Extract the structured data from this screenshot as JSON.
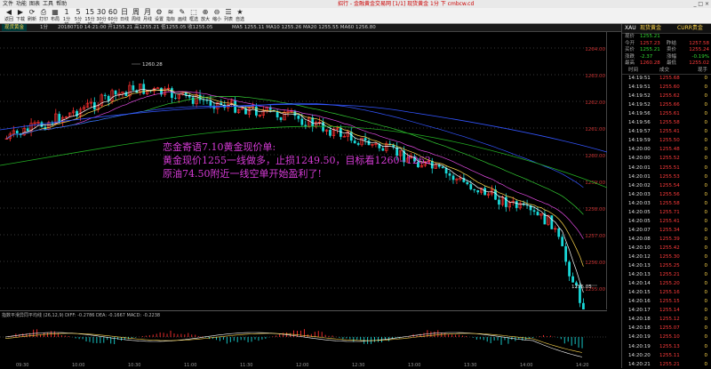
{
  "titlebar": {
    "menus": [
      "文件",
      "功能",
      "图表",
      "工具",
      "帮助"
    ],
    "title": "招行 - 金融黄金交易网 [1/1] 现货黄金 1分 下 cmbcw.cd",
    "win_controls": "_ □ ×"
  },
  "toolbar": {
    "buttons": [
      {
        "glyph": "◀",
        "label": "返回",
        "icon": "back-icon"
      },
      {
        "glyph": "▶",
        "label": "下载",
        "icon": "forward-icon"
      },
      {
        "glyph": "⟳",
        "label": "刷新",
        "icon": "refresh-icon"
      },
      {
        "glyph": "⎙",
        "label": "打印",
        "icon": "print-icon"
      },
      {
        "glyph": "▦",
        "label": "布局",
        "icon": "layout-icon"
      },
      {
        "glyph": "1",
        "label": "1分钟"
      },
      {
        "glyph": "5",
        "label": "5分钟"
      },
      {
        "glyph": "15",
        "label": "15分钟"
      },
      {
        "glyph": "30",
        "label": "30分钟"
      },
      {
        "glyph": "60",
        "label": "60分钟"
      },
      {
        "glyph": "日",
        "label": "日线"
      },
      {
        "glyph": "周",
        "label": "周线"
      },
      {
        "glyph": "月",
        "label": "月线"
      },
      {
        "glyph": "⚙",
        "label": "设置",
        "icon": "gear-icon"
      },
      {
        "glyph": "≋",
        "label": "指标",
        "icon": "indicator-icon"
      },
      {
        "glyph": "✎",
        "label": "画线",
        "icon": "pencil-icon"
      },
      {
        "glyph": "⬚",
        "label": "框选",
        "icon": "select-icon"
      },
      {
        "glyph": "⊕",
        "label": "放大",
        "icon": "zoom-in-icon"
      },
      {
        "glyph": "⊖",
        "label": "缩小",
        "icon": "zoom-out-icon"
      },
      {
        "glyph": "☰",
        "label": "列表",
        "icon": "list-icon"
      },
      {
        "glyph": "★",
        "label": "自选",
        "icon": "star-icon"
      }
    ]
  },
  "tabs": [
    {
      "label": "现货黄金",
      "active": true
    },
    {
      "label": "1分"
    },
    {
      "label": "20180710 14:21:00 开1255.21 高1255.21 低1255.05 收1255.05"
    },
    {
      "label": "MA5 1255.11 MA10 1255.26 MA20 1255.55 MA60 1256.80"
    }
  ],
  "chart": {
    "price_labels": [
      "1264.00",
      "1263.00",
      "1262.00",
      "1261.00",
      "1260.00",
      "1259.00",
      "1258.00",
      "1257.00",
      "1256.00",
      "1255.00"
    ],
    "high_label": "1260.28",
    "low_label": "1255.05",
    "sub_label": "指数平滑异同平均线 (26,12,9)  DIFF: -0.2786  DEA: -0.1667  MACD: -0.2238",
    "time_labels": [
      "09:30",
      "10:00",
      "10:30",
      "11:00",
      "11:30",
      "12:00",
      "12:30",
      "13:00",
      "13:30",
      "14:00",
      "14:20"
    ]
  },
  "annotation": {
    "line1": "恋金寄语7.10黄金现价单:",
    "line2": "黄金现价1255一线做多，止损1249.50，目标看1260--1262",
    "line3": "原油74.50附近一线空单开始盈利了!"
  },
  "quote": {
    "symbol": "XAU",
    "name": "现货黄金",
    "currency": "CURR贵金",
    "rows": [
      {
        "label": "现价",
        "value": "1255.21",
        "label2": "",
        "value2": ""
      },
      {
        "label": "今开",
        "value": "1257.23",
        "label2": "昨结",
        "value2": "1257.58"
      },
      {
        "label": "买价",
        "value": "1255.21",
        "label2": "卖价",
        "value2": "1255.24"
      },
      {
        "label": "涨跌",
        "value": "-2.37",
        "label2": "涨幅",
        "value2": "-0.19%"
      },
      {
        "label": "最高",
        "value": "1260.28",
        "label2": "最低",
        "value2": "1255.02"
      }
    ],
    "header": {
      "time": "时间",
      "price": "成交",
      "vol": "现手"
    },
    "ticks": [
      {
        "t": "14:19:51",
        "p": "1255.68",
        "v": "0"
      },
      {
        "t": "14:19:51",
        "p": "1255.60",
        "v": "0"
      },
      {
        "t": "14:19:52",
        "p": "1255.62",
        "v": "0"
      },
      {
        "t": "14:19:52",
        "p": "1255.66",
        "v": "0"
      },
      {
        "t": "14:19:56",
        "p": "1255.61",
        "v": "0"
      },
      {
        "t": "14:19:56",
        "p": "1255.58",
        "v": "0"
      },
      {
        "t": "14:19:57",
        "p": "1255.41",
        "v": "0"
      },
      {
        "t": "14:19:59",
        "p": "1255.50",
        "v": "0"
      },
      {
        "t": "14:20:00",
        "p": "1255.48",
        "v": "0"
      },
      {
        "t": "14:20:00",
        "p": "1255.52",
        "v": "0"
      },
      {
        "t": "14:20:01",
        "p": "1255.51",
        "v": "0"
      },
      {
        "t": "14:20:01",
        "p": "1255.53",
        "v": "0"
      },
      {
        "t": "14:20:02",
        "p": "1255.54",
        "v": "0"
      },
      {
        "t": "14:20:03",
        "p": "1255.56",
        "v": "0"
      },
      {
        "t": "14:20:03",
        "p": "1255.58",
        "v": "0"
      },
      {
        "t": "14:20:05",
        "p": "1255.71",
        "v": "0"
      },
      {
        "t": "14:20:05",
        "p": "1255.41",
        "v": "0"
      },
      {
        "t": "14:20:07",
        "p": "1255.34",
        "v": "0"
      },
      {
        "t": "14:20:08",
        "p": "1255.39",
        "v": "0"
      },
      {
        "t": "14:20:10",
        "p": "1255.42",
        "v": "0"
      },
      {
        "t": "14:20:12",
        "p": "1255.30",
        "v": "0"
      },
      {
        "t": "14:20:13",
        "p": "1255.25",
        "v": "0"
      },
      {
        "t": "14:20:13",
        "p": "1255.21",
        "v": "0"
      },
      {
        "t": "14:20:14",
        "p": "1255.20",
        "v": "0"
      },
      {
        "t": "14:20:15",
        "p": "1255.16",
        "v": "0"
      },
      {
        "t": "14:20:16",
        "p": "1255.15",
        "v": "0"
      },
      {
        "t": "14:20:17",
        "p": "1255.14",
        "v": "0"
      },
      {
        "t": "14:20:18",
        "p": "1255.12",
        "v": "0"
      },
      {
        "t": "14:20:18",
        "p": "1255.07",
        "v": "0"
      },
      {
        "t": "14:20:19",
        "p": "1255.10",
        "v": "0"
      },
      {
        "t": "14:20:19",
        "p": "1255.13",
        "v": "0"
      },
      {
        "t": "14:20:20",
        "p": "1255.11",
        "v": "0"
      },
      {
        "t": "14:20:21",
        "p": "1255.21",
        "v": "0"
      }
    ]
  }
}
